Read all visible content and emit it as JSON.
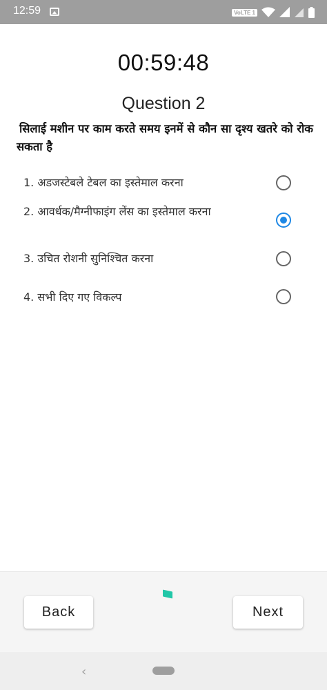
{
  "status_bar": {
    "time": "12:59",
    "notification_icon": "image-icon",
    "network_badge": "VoLTE 1",
    "icons": [
      "wifi-icon",
      "signal-icon",
      "signal-icon",
      "battery-icon"
    ]
  },
  "quiz": {
    "timer": "00:59:48",
    "question_number": "Question 2",
    "question_text": "सिलाई मशीन पर काम करते समय इनमें से कौन सा दृश्य खतरे को रोक सकता है",
    "options": [
      {
        "label": "1. अडजस्टेबले टेबल का इस्तेमाल करना",
        "selected": false
      },
      {
        "label": "2. आवर्धक/मैग्नीफाइंग  लेंस का इस्तेमाल करना",
        "selected": true
      },
      {
        "label": "3. उचित रोशनी सुनिश्चित करना",
        "selected": false
      },
      {
        "label": "4.  सभी दिए गए विकल्प",
        "selected": false
      }
    ]
  },
  "buttons": {
    "back_label": "Back",
    "next_label": "Next"
  },
  "colors": {
    "accent": "#1e88e5",
    "status_bar": "#9e9e9e",
    "loader": "#21c7a8"
  }
}
